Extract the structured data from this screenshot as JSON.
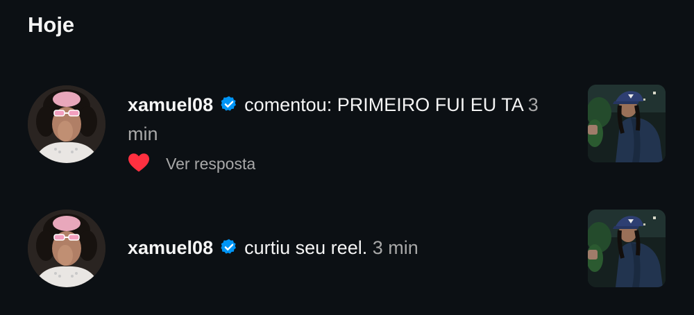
{
  "section": {
    "title": "Hoje"
  },
  "notifications": [
    {
      "username": "xamuel08",
      "action": "comentou: PRIMEIRO FUI EU TA",
      "time": "3 min",
      "reply_label": "Ver resposta",
      "liked": true,
      "heart_color": "#ff3040"
    },
    {
      "username": "xamuel08",
      "action": "curtiu seu reel.",
      "time": "3 min"
    }
  ],
  "colors": {
    "background": "#0c1014",
    "text": "#f5f5f5",
    "muted": "#a8a8a8",
    "verified": "#0095f6",
    "heart": "#ff3040"
  },
  "icons": {
    "verified": "verified-badge-icon",
    "heart": "heart-icon"
  }
}
